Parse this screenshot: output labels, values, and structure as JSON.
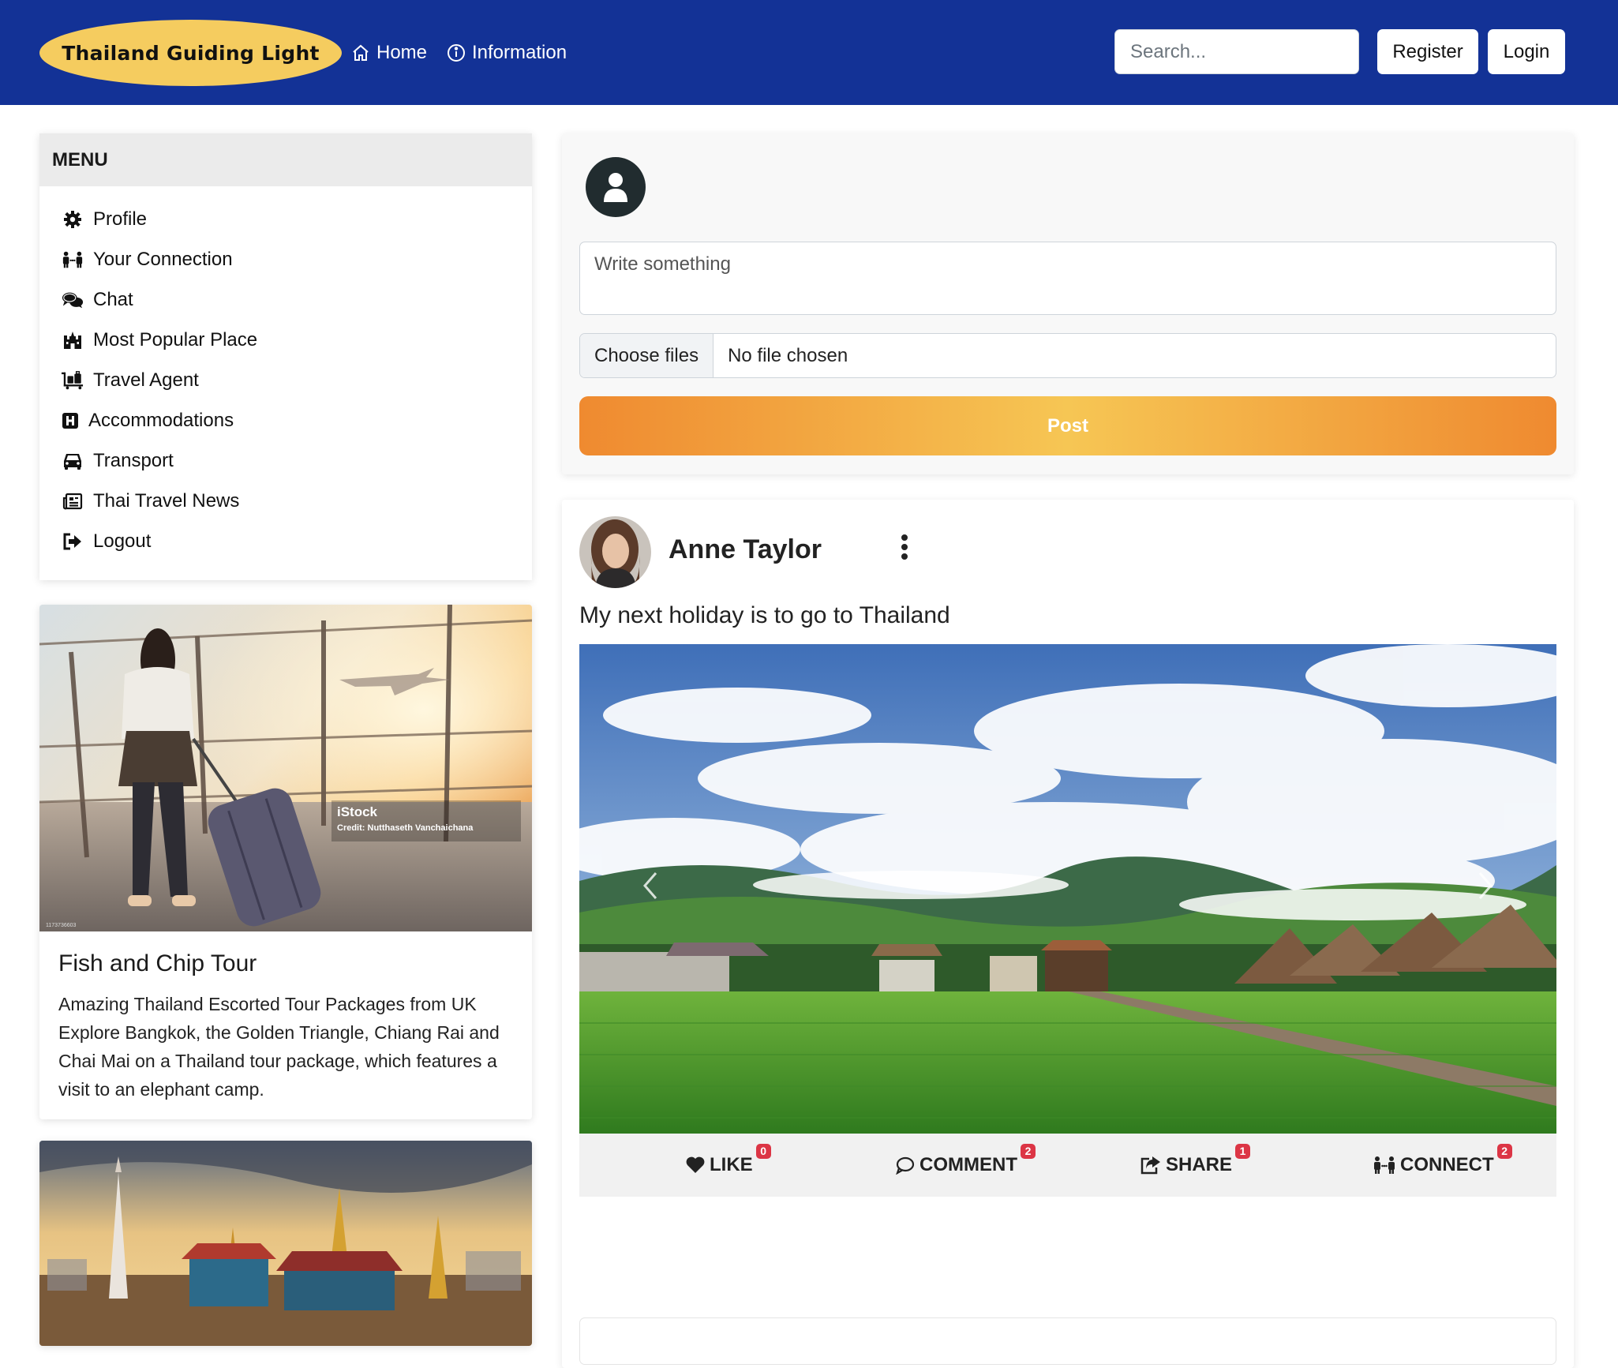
{
  "navbar": {
    "brand": "Thailand Guiding Light",
    "links": [
      {
        "label": "Home",
        "icon": "home-icon"
      },
      {
        "label": "Information",
        "icon": "info-circle-icon"
      }
    ],
    "search_placeholder": "Search...",
    "register_label": "Register",
    "login_label": "Login",
    "colors": {
      "bar": "#133296",
      "brand_bg": "#f5cc5f"
    }
  },
  "sidebar": {
    "title": "MENU",
    "items": [
      {
        "label": "Profile",
        "icon": "gear-icon"
      },
      {
        "label": "Your Connection",
        "icon": "people-connect-icon"
      },
      {
        "label": "Chat",
        "icon": "chat-bubbles-icon"
      },
      {
        "label": "Most Popular Place",
        "icon": "landmark-icon"
      },
      {
        "label": "Travel Agent",
        "icon": "luggage-cart-icon"
      },
      {
        "label": "Accommodations",
        "icon": "hotel-h-icon"
      },
      {
        "label": "Transport",
        "icon": "car-icon"
      },
      {
        "label": "Thai Travel News",
        "icon": "newspaper-icon"
      },
      {
        "label": "Logout",
        "icon": "logout-icon"
      }
    ]
  },
  "tour_card": {
    "image_watermark": "iStock",
    "image_credit": "Credit: Nutthaseth Vanchaichana",
    "image_id": "1173736603",
    "title": "Fish and Chip Tour",
    "text": "Amazing Thailand Escorted Tour Packages from UK Explore Bangkok, the Golden Triangle, Chiang Rai and Chai Mai on a Thailand tour package, which features a visit to an elephant camp."
  },
  "composer": {
    "placeholder": "Write something",
    "choose_files_label": "Choose files",
    "file_status": "No file chosen",
    "post_label": "Post"
  },
  "post": {
    "author": "Anne Taylor",
    "text": "My next holiday is to go to Thailand",
    "actions": [
      {
        "label": "LIKE",
        "icon": "heart-icon",
        "count": "0"
      },
      {
        "label": "COMMENT",
        "icon": "comment-icon",
        "count": "2"
      },
      {
        "label": "SHARE",
        "icon": "share-icon",
        "count": "1"
      },
      {
        "label": "CONNECT",
        "icon": "people-connect-icon",
        "count": "2"
      }
    ]
  }
}
